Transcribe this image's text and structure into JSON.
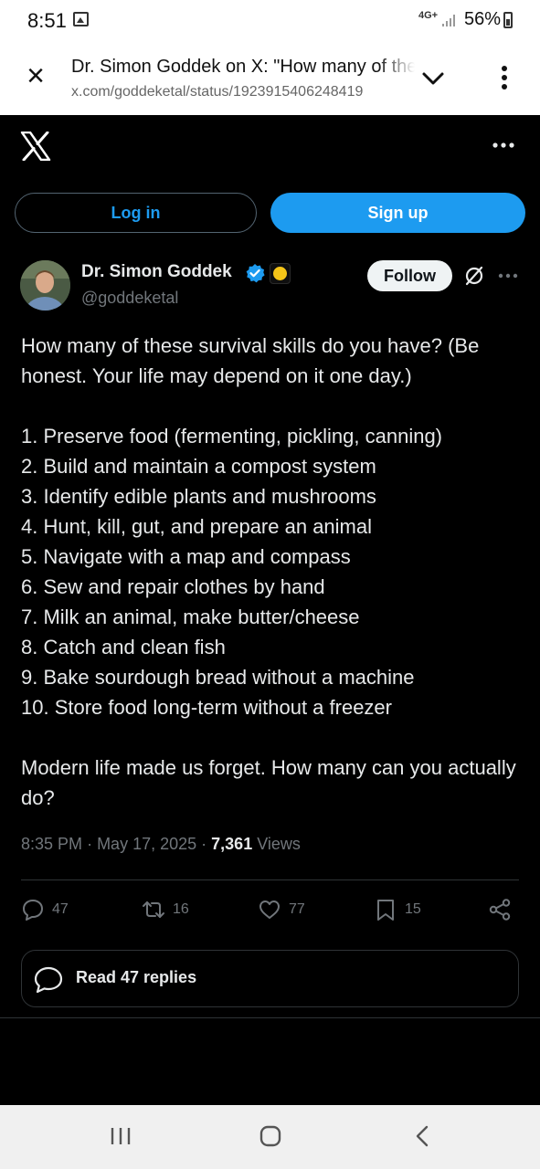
{
  "status_bar": {
    "time": "8:51",
    "network": "4G+",
    "battery": "56%"
  },
  "browser": {
    "title": "Dr. Simon Goddek on X: \"How many of these survival skills do you have?",
    "url": "x.com/goddeketal/status/1923915406248419"
  },
  "auth": {
    "login_label": "Log in",
    "signup_label": "Sign up"
  },
  "author": {
    "name": "Dr. Simon Goddek",
    "handle": "@goddeketal",
    "follow_label": "Follow"
  },
  "tweet": {
    "intro": "How many of these survival skills do you have? (Be honest. Your life may depend on it one day.)",
    "items": [
      "1. Preserve food (fermenting, pickling, canning)",
      "2. Build and maintain a compost system",
      "3. Identify edible plants and mushrooms",
      "4. Hunt, kill, gut, and prepare an animal",
      "5. Navigate with a map and compass",
      "6. Sew and repair clothes by hand",
      "7. Milk an animal, make butter/cheese",
      "8. Catch and clean fish",
      "9. Bake sourdough bread without a machine",
      "10. Store food long-term without a freezer"
    ],
    "outro": "Modern life made us forget. How many can you actually do?",
    "time": "8:35 PM",
    "date": "May 17, 2025",
    "views_count": "7,361",
    "views_label": "Views"
  },
  "actions": {
    "replies": "47",
    "reposts": "16",
    "likes": "77",
    "bookmarks": "15"
  },
  "read_replies": {
    "label": "Read 47 replies"
  },
  "colors": {
    "accent": "#1d9bf0",
    "background": "#000000",
    "text": "#e7e9ea",
    "muted": "#71767b"
  },
  "icons": [
    "close-icon",
    "chevron-down-icon",
    "overflow-menu-icon",
    "x-logo-icon",
    "more-icon",
    "verified-badge-icon",
    "grok-icon",
    "reply-icon",
    "repost-icon",
    "like-icon",
    "bookmark-icon",
    "share-icon",
    "speech-bubble-icon"
  ]
}
